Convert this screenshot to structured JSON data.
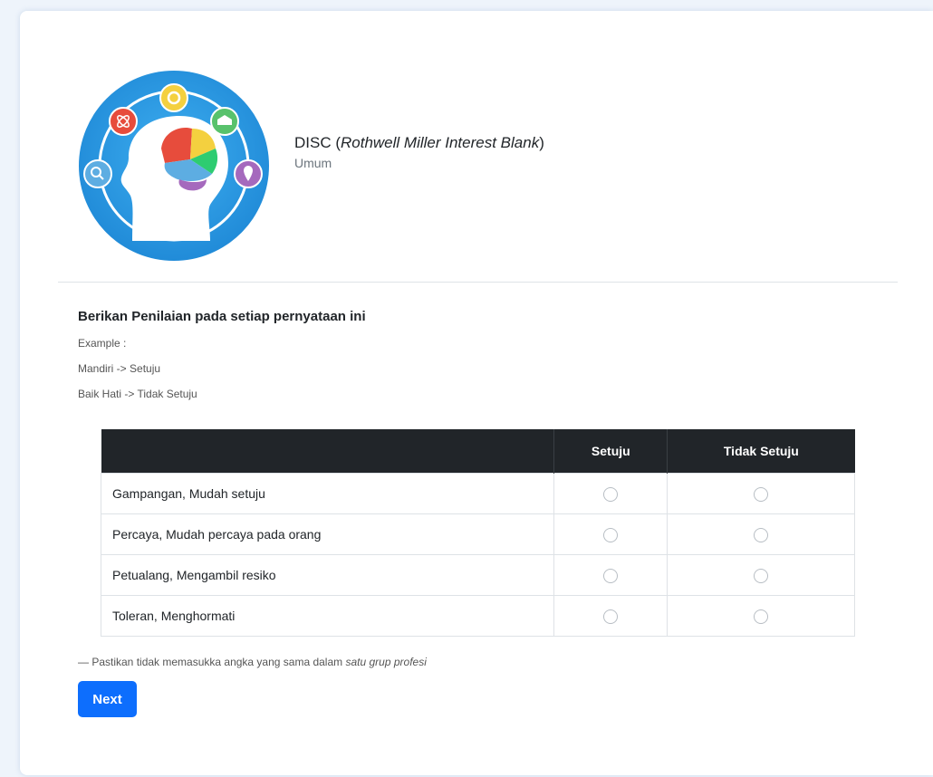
{
  "header": {
    "title_main": "DISC (",
    "title_italic": "Rothwell Miller Interest Blank",
    "title_close": ")",
    "subtitle": "Umum"
  },
  "instructions": {
    "title": "Berikan Penilaian pada setiap pernyataan ini",
    "example_label": "Example :",
    "example_1": "Mandiri -> Setuju",
    "example_2": "Baik Hati -> Tidak Setuju"
  },
  "table": {
    "columns": [
      "",
      "Setuju",
      "Tidak Setuju"
    ],
    "rows": [
      "Gampangan, Mudah setuju",
      "Percaya, Mudah percaya pada orang",
      "Petualang, Mengambil resiko",
      "Toleran, Menghormati"
    ]
  },
  "footer": {
    "note_prefix": "— Pastikan tidak memasukka angka yang sama dalam ",
    "note_italic": "satu grup profesi",
    "next_label": "Next"
  },
  "colors": {
    "accent": "#0d6efd",
    "table_header": "#212529",
    "logo_ring": "#2a9be0"
  },
  "icons": [
    "brain-head-logo",
    "atom-icon",
    "gear-icon",
    "school-icon",
    "magnifier-icon",
    "location-pin-icon"
  ]
}
